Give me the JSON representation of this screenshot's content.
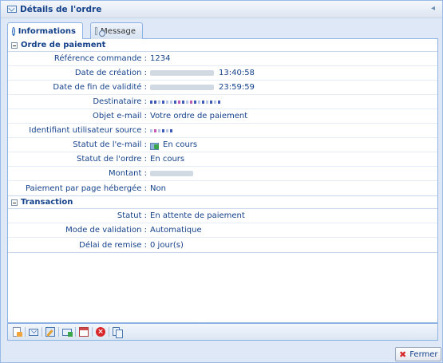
{
  "window": {
    "title": "Détails de l'ordre"
  },
  "tabs": [
    {
      "label": "Informations",
      "active": true,
      "icon": "info-icon"
    },
    {
      "label": "Message",
      "active": false,
      "icon": "message-icon"
    }
  ],
  "sections": {
    "payment_order": {
      "title": "Ordre de paiement",
      "rows": [
        {
          "label": "Référence commande :",
          "value": "1234"
        },
        {
          "label": "Date de création :",
          "value": "13:40:58",
          "redacted": true
        },
        {
          "label": "Date de fin de validité :",
          "value": "23:59:59",
          "redacted": true
        },
        {
          "label": "Destinataire :",
          "value": "",
          "redacted": true
        },
        {
          "label": "Objet e-mail :",
          "value": "Votre ordre de paiement"
        },
        {
          "label": "Identifiant utilisateur source :",
          "value": "",
          "redacted": true
        },
        {
          "label": "Statut de l'e-mail :",
          "value": "En cours",
          "icon": "mail-send-icon"
        },
        {
          "label": "Statut de l'ordre :",
          "value": "En cours"
        },
        {
          "label": "Montant :",
          "value": "",
          "redacted": true
        },
        {
          "label": "Paiement par page hébergée :",
          "value": "Non"
        }
      ]
    },
    "transaction": {
      "title": "Transaction",
      "rows": [
        {
          "label": "Statut :",
          "value": "En attente de paiement"
        },
        {
          "label": "Mode de validation :",
          "value": "Automatique"
        },
        {
          "label": "Délai de remise :",
          "value": "0 jour(s)"
        }
      ]
    }
  },
  "toolbar": {
    "icons": [
      "document-icon",
      "mail-icon",
      "edit-icon",
      "mail-forward-icon",
      "calendar-icon",
      "delete-icon",
      "copy-icon"
    ]
  },
  "footer": {
    "close_label": "Fermer"
  },
  "colors": {
    "label_text": "#15428b",
    "panel_border": "#99bbe8",
    "close_x": "#d62a2a"
  }
}
